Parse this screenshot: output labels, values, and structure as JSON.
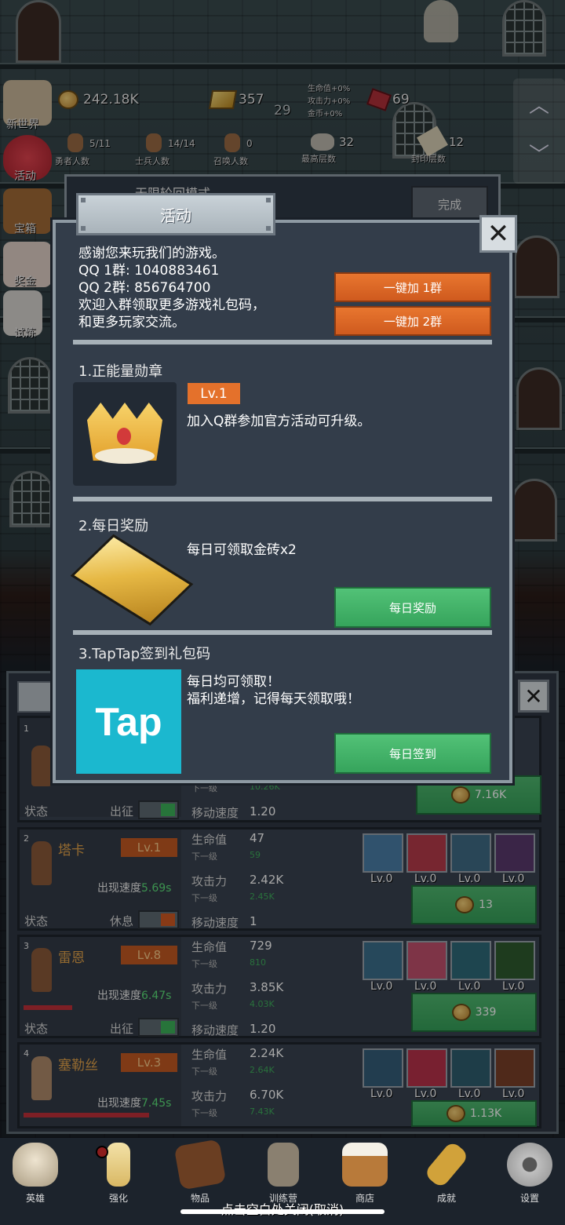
{
  "hud": {
    "left_menu": [
      {
        "label": "新世界",
        "icon": "map-icon"
      },
      {
        "label": "活动",
        "icon": "heart-icon"
      },
      {
        "label": "宝箱",
        "icon": "chest-icon"
      },
      {
        "label": "奖金",
        "icon": "envelope-icon"
      },
      {
        "label": "试炼",
        "icon": "feather-icon"
      }
    ],
    "gold": "242.18K",
    "gold_bar": "357",
    "level": "29",
    "bonus_lines": [
      "生命值+0%",
      "攻击力+0%",
      "金币+0%"
    ],
    "gems": "69",
    "stats": [
      {
        "value": "5/11",
        "label": "勇者人数"
      },
      {
        "value": "14/14",
        "label": "士兵人数"
      },
      {
        "value": "0",
        "label": "召唤人数"
      },
      {
        "value": "32",
        "label": "最高层数"
      },
      {
        "value": "12",
        "label": "封印层数"
      }
    ]
  },
  "behind": {
    "mode_title": "无限轮回模式",
    "done_button": "完成"
  },
  "dialog": {
    "title": "活动",
    "intro_lines": [
      "感谢您来玩我们的游戏。",
      "QQ 1群: 1040883461",
      "QQ 2群: 856764700",
      "欢迎入群领取更多游戏礼包码，",
      "和更多玩家交流。"
    ],
    "join1": "一键加 1群",
    "join2": "一键加 2群",
    "sec1_title": "1.正能量勋章",
    "sec1_level": "Lv.1",
    "sec1_desc": "加入Q群参加官方活动可升级。",
    "sec2_title": "2.每日奖励",
    "sec2_desc": "每日可领取金砖x2",
    "sec2_button": "每日奖励",
    "sec3_title": "3.TapTap签到礼包码",
    "sec3_logo": "Tap",
    "sec3_desc1": "每日均可领取！",
    "sec3_desc2": "福利递增，记得每天领取哦！",
    "sec3_button": "每日签到"
  },
  "heroes": {
    "partial_row": {
      "num": "1",
      "status_label": "状态",
      "status_value": "出征",
      "next_label": "下一级",
      "next_value": "10.26K",
      "speed_label": "移动速度",
      "speed_value": "1.20",
      "cost": "7.16K"
    },
    "rows": [
      {
        "num": "2",
        "name": "塔卡",
        "lv": "Lv.1",
        "appear_label": "出现速度",
        "appear": "5.69s",
        "status_label": "状态",
        "status": "休息",
        "hp_label": "生命值",
        "hp": "47",
        "hp_next_label": "下一级",
        "hp_next": "59",
        "atk_label": "攻击力",
        "atk": "2.42K",
        "atk_next_label": "下一级",
        "atk_next": "2.45K",
        "spd_label": "移动速度",
        "spd": "1",
        "cost": "13",
        "skills": [
          "Lv.0",
          "Lv.0",
          "Lv.0",
          "Lv.0"
        ]
      },
      {
        "num": "3",
        "name": "雷恩",
        "lv": "Lv.8",
        "appear_label": "出现速度",
        "appear": "6.47s",
        "status_label": "状态",
        "status": "出征",
        "hp_label": "生命值",
        "hp": "729",
        "hp_next_label": "下一级",
        "hp_next": "810",
        "atk_label": "攻击力",
        "atk": "3.85K",
        "atk_next_label": "下一级",
        "atk_next": "4.03K",
        "spd_label": "移动速度",
        "spd": "1.20",
        "cost": "339",
        "skills": [
          "Lv.0",
          "Lv.0",
          "Lv.0",
          "Lv.0"
        ]
      },
      {
        "num": "4",
        "name": "塞勒丝",
        "lv": "Lv.3",
        "appear_label": "出现速度",
        "appear": "7.45s",
        "hp_label": "生命值",
        "hp": "2.24K",
        "hp_next_label": "下一级",
        "hp_next": "2.64K",
        "atk_label": "攻击力",
        "atk": "6.70K",
        "atk_next_label": "下一级",
        "atk_next": "7.43K",
        "cost": "1.13K",
        "skills": [
          "Lv.0",
          "Lv.0",
          "Lv.0",
          "Lv.0"
        ]
      }
    ]
  },
  "nav": [
    {
      "label": "英雄",
      "icon": "skull-icon"
    },
    {
      "label": "强化",
      "icon": "candle-icon"
    },
    {
      "label": "物品",
      "icon": "book-icon"
    },
    {
      "label": "训练营",
      "icon": "lantern-icon"
    },
    {
      "label": "商店",
      "icon": "mug-icon"
    },
    {
      "label": "成就",
      "icon": "key-icon"
    },
    {
      "label": "设置",
      "icon": "gear-icon"
    }
  ],
  "close_hint": "点击空白处关闭(取消)",
  "colors": {
    "orange": "#e4712b",
    "green": "#42b366",
    "panel": "#333d4a",
    "tap_blue": "#1bb8cf"
  }
}
